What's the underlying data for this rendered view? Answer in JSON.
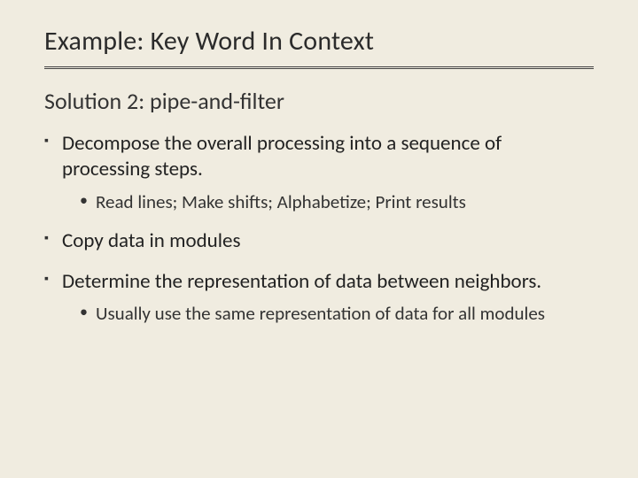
{
  "title": "Example: Key Word In Context",
  "subtitle": "Solution 2: pipe-and-filter",
  "bullets": [
    {
      "text": "Decompose the overall processing into a sequence of processing steps.",
      "sub": [
        "Read lines; Make shifts; Alphabetize; Print results"
      ]
    },
    {
      "text": "Copy data in modules",
      "sub": []
    },
    {
      "text": "Determine the representation of data between neighbors.",
      "sub": [
        "Usually use the same representation of data for all modules"
      ]
    }
  ]
}
